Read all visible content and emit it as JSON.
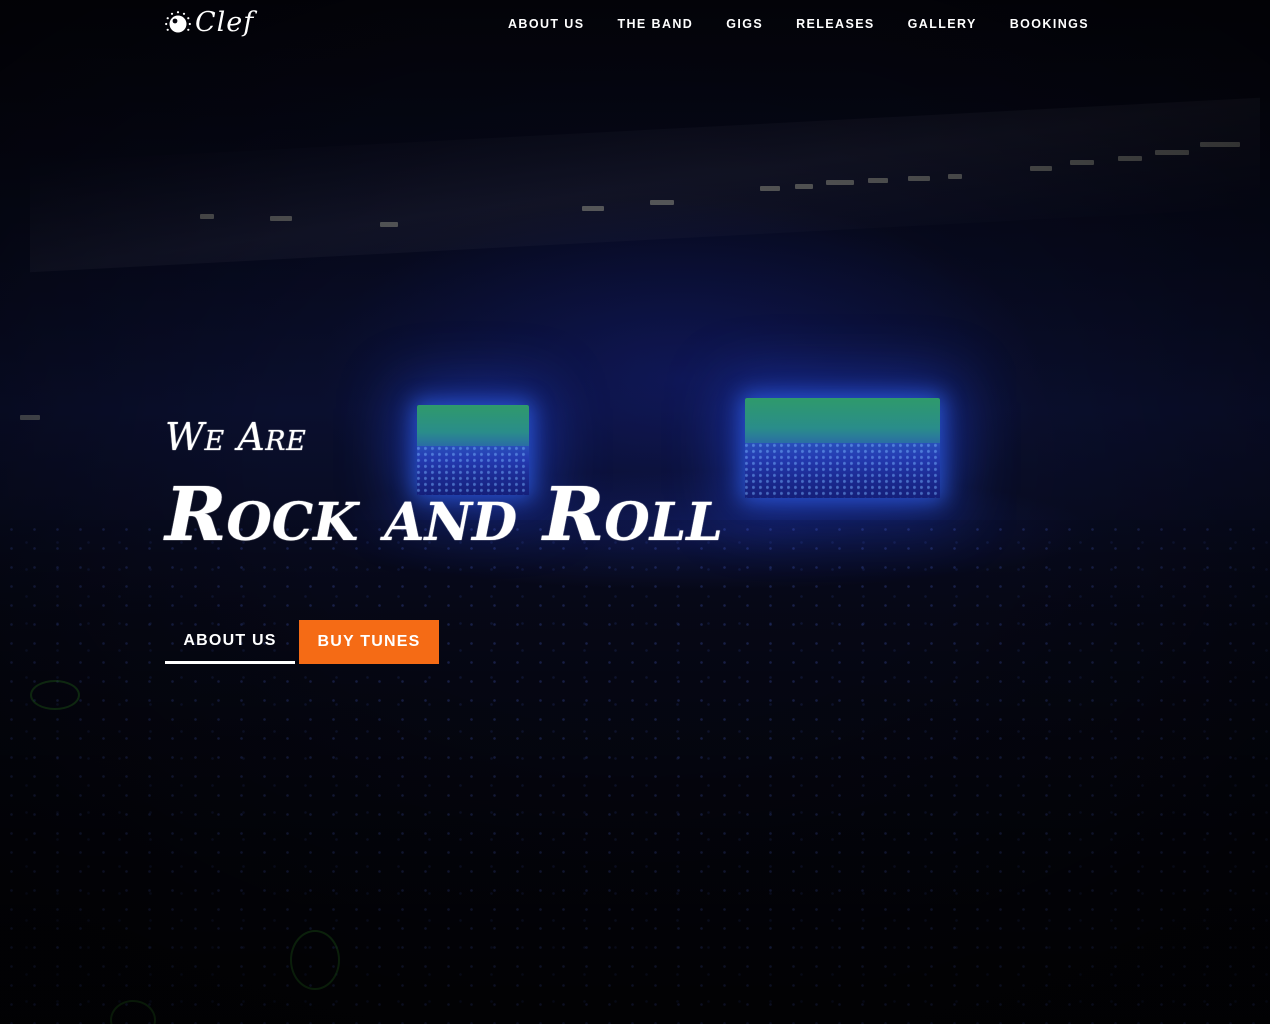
{
  "brand": {
    "name": "Clef",
    "logo_icon": "knob-icon"
  },
  "nav": {
    "items": [
      {
        "label": "ABOUT US"
      },
      {
        "label": "THE BAND"
      },
      {
        "label": "GIGS"
      },
      {
        "label": "RELEASES"
      },
      {
        "label": "GALLERY"
      },
      {
        "label": "BOOKINGS"
      }
    ]
  },
  "hero": {
    "tagline": "We Are",
    "headline": "Rock and Roll",
    "background": "concert-crowd-photo"
  },
  "buttons": {
    "about_label": "ABOUT US",
    "buy_label": "BUY TUNES"
  },
  "colors": {
    "accent": "#f56b15",
    "text": "#ffffff",
    "background": "#05050d"
  }
}
